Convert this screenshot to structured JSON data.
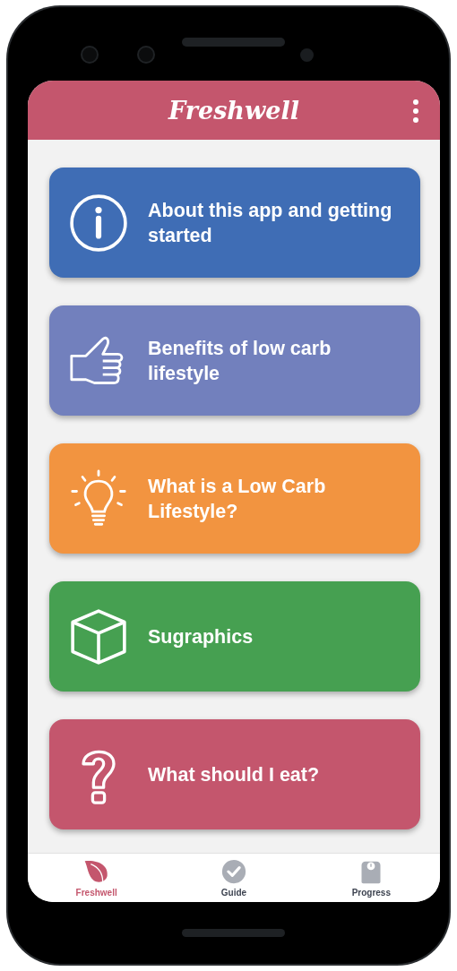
{
  "app_bar": {
    "logo": "Freshwell"
  },
  "cards": [
    {
      "kind": "info",
      "label": "About this app and getting started",
      "color": "#3f6db5"
    },
    {
      "kind": "thumb",
      "label": "Benefits of low carb lifestyle",
      "color": "#7280bd"
    },
    {
      "kind": "bulb",
      "label": "What is a Low Carb Lifestyle?",
      "color": "#f29440"
    },
    {
      "kind": "cube",
      "label": "Sugraphics",
      "color": "#46a051"
    },
    {
      "kind": "question",
      "label": "What should I eat?",
      "color": "#c4566d"
    }
  ],
  "tab_bar": [
    {
      "kind": "leaf",
      "label": "Freshwell",
      "selected": true
    },
    {
      "kind": "check",
      "label": "Guide",
      "selected": false
    },
    {
      "kind": "scale",
      "label": "Progress",
      "selected": false
    }
  ]
}
